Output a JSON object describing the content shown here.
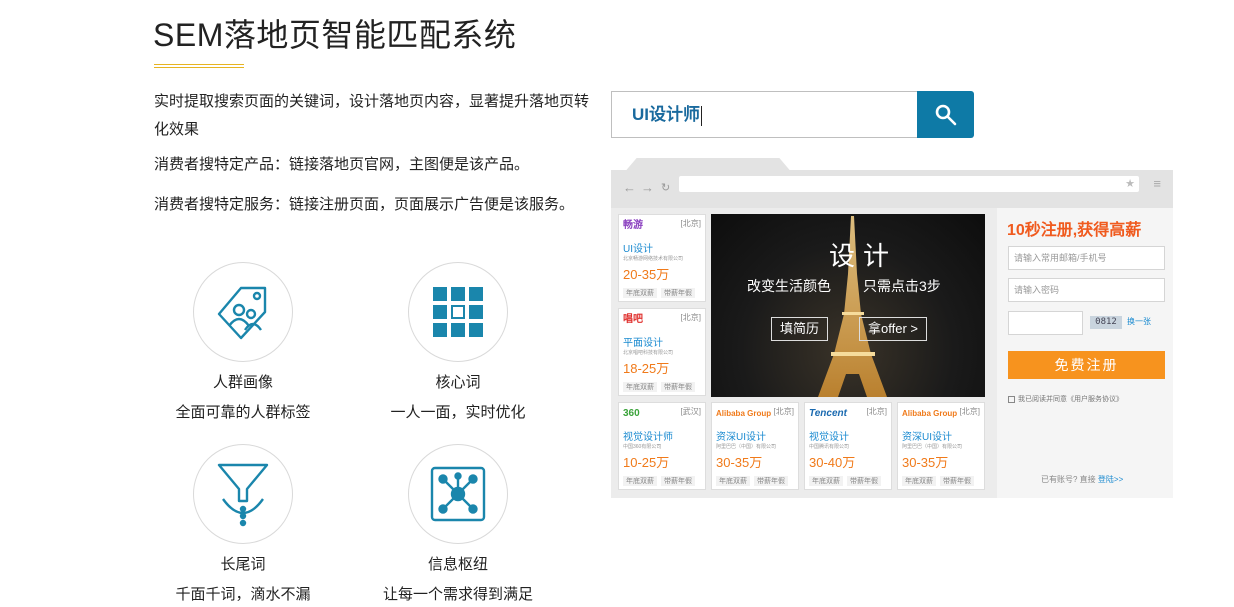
{
  "header": {
    "title": "SEM落地页智能匹配系统",
    "accent_color": "#e6b422"
  },
  "intro": {
    "line1": "实时提取搜索页面的关键词，设计落地页内容，显著提升落地页转化效果",
    "line2": "消费者搜特定产品：链接落地页官网，主图便是该产品。",
    "line3": "消费者搜特定服务：链接注册页面，页面展示广告便是该服务。"
  },
  "features": [
    {
      "name": "人群画像",
      "desc": "全面可靠的人群标签",
      "icon": "crowd-tag-icon"
    },
    {
      "name": "核心词",
      "desc": "一人一面，实时优化",
      "icon": "grid-core-icon"
    },
    {
      "name": "长尾词",
      "desc": "千面千词，滴水不漏",
      "icon": "funnel-icon"
    },
    {
      "name": "信息枢纽",
      "desc": "让每一个需求得到满足",
      "icon": "network-hub-icon"
    }
  ],
  "search": {
    "value": "UI设计师",
    "button_icon": "search-icon",
    "button_color": "#0e7aa6"
  },
  "mock_browser": {
    "cards_left": [
      {
        "logo": "畅游",
        "city": "[北京]",
        "job": "UI设计",
        "company": "北京畅游网络技术有限公司",
        "salary": "20-35万",
        "tags": [
          "年底双薪",
          "带薪年假"
        ],
        "logo_color": "#8a3fbf"
      },
      {
        "logo": "唱吧",
        "city": "[北京]",
        "job": "平面设计",
        "company": "北京唱吧科技有限公司",
        "salary": "18-25万",
        "tags": [
          "年底双薪",
          "带薪年假"
        ],
        "logo_color": "#e0322f"
      }
    ],
    "cards_bottom": [
      {
        "logo": "360",
        "city": "[武汉]",
        "job": "视觉设计师",
        "company": "中国360有限公司",
        "salary": "10-25万",
        "tags": [
          "年底双薪",
          "带薪年假"
        ],
        "logo_color": "#3aa33a"
      },
      {
        "logo": "Alibaba Group",
        "city": "[北京]",
        "job": "资深UI设计",
        "company": "阿里巴巴（中国）有限公司",
        "salary": "30-35万",
        "tags": [
          "年底双薪",
          "带薪年假"
        ],
        "logo_color": "#f07a1a"
      },
      {
        "logo": "Tencent",
        "city": "[北京]",
        "job": "视觉设计",
        "company": "中国腾讯有限公司",
        "salary": "30-40万",
        "tags": [
          "年底双薪",
          "带薪年假"
        ],
        "logo_color": "#1a6ab0"
      },
      {
        "logo": "Alibaba Group",
        "city": "[北京]",
        "job": "资深UI设计",
        "company": "阿里巴巴（中国）有限公司",
        "salary": "30-35万",
        "tags": [
          "年底双薪",
          "带薪年假"
        ],
        "logo_color": "#f07a1a"
      }
    ],
    "banner": {
      "title": "设计",
      "sub1": "改变生活颜色",
      "sub2": "只需点击3步",
      "btn1": "填简历",
      "btn2": "拿offer >"
    },
    "register": {
      "title": "10秒注册,获得高薪",
      "email_placeholder": "请输入常用邮箱/手机号",
      "password_placeholder": "请输入密码",
      "captcha": "0812",
      "captcha_change": "换一张",
      "submit": "免费注册",
      "agree": "我已阅读并同意《用户服务协议》",
      "login_prompt": "已有账号? 直接",
      "login_link": "登陆>>"
    }
  }
}
